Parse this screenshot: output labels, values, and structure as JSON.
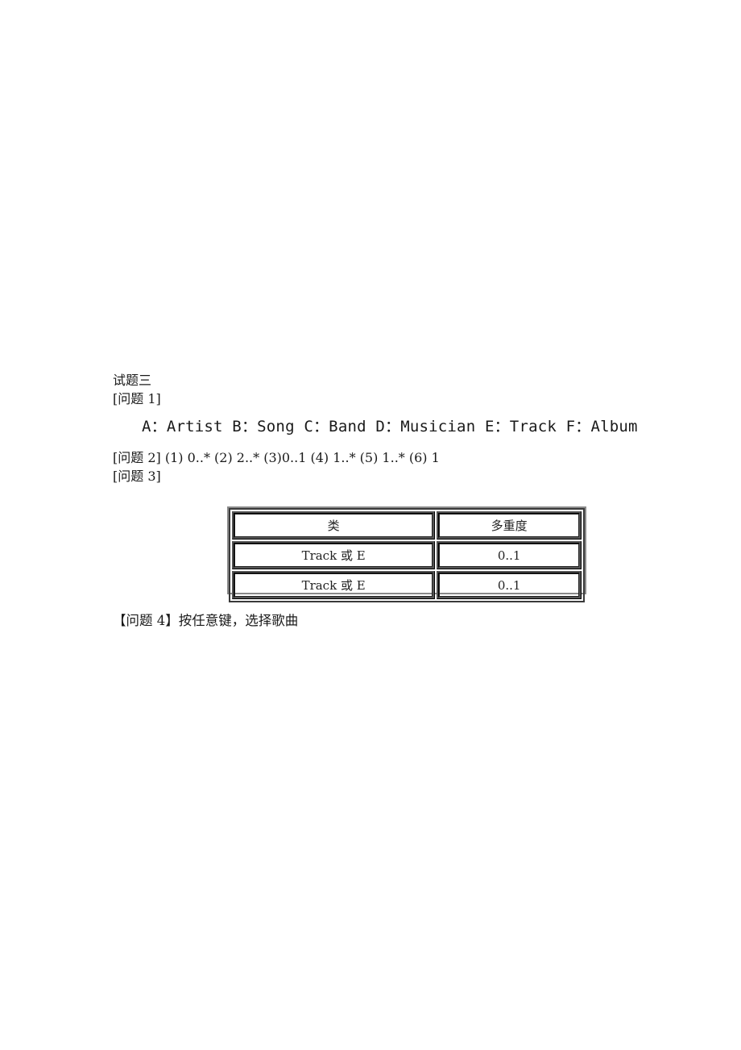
{
  "document": {
    "title": "试题三",
    "question1": {
      "label": "[问题 1]",
      "answer": "A：Artist B：Song C：Band D：Musician E：Track F：Album"
    },
    "question2": {
      "line": "[问题 2] (1) 0..* (2) 2..* (3)0..1 (4) 1..* (5) 1..* (6) 1"
    },
    "question3": {
      "label": "[问题 3]",
      "table": {
        "headers": [
          "类",
          "多重度"
        ],
        "rows": [
          [
            "Track 或 E",
            "0..1"
          ],
          [
            "Track 或 E",
            "0..1"
          ]
        ]
      }
    },
    "question4": {
      "line": "【问题 4】按任意键，选择歌曲"
    }
  }
}
